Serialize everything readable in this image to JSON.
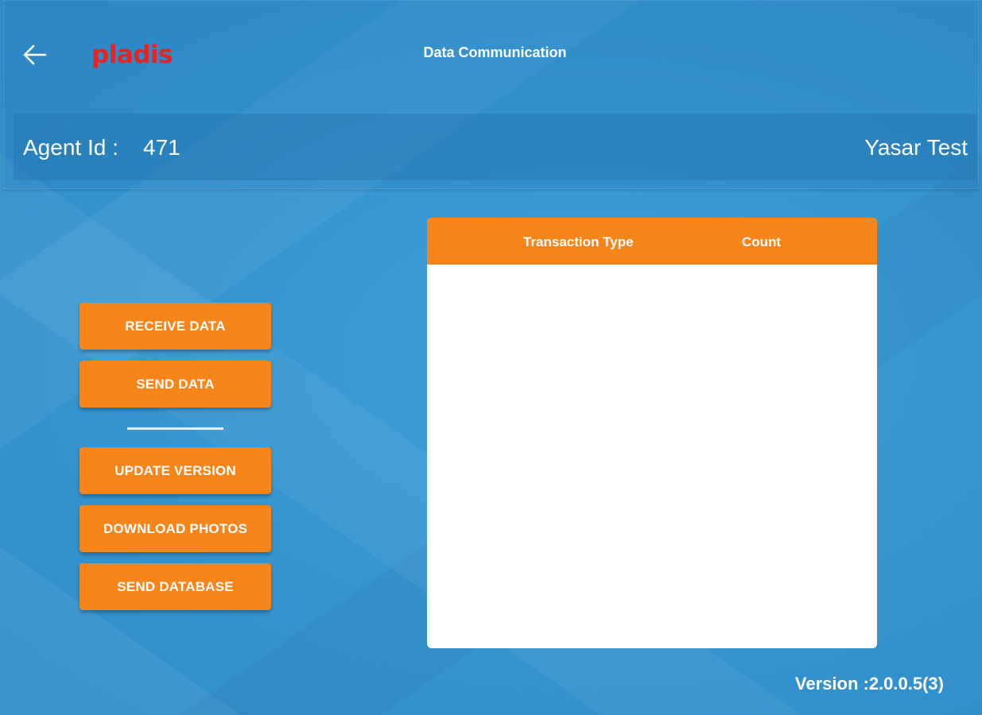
{
  "header": {
    "back_icon": "arrow-left-icon",
    "logo_text": "pladis",
    "title": "Data Communication"
  },
  "agent": {
    "label": "Agent Id :",
    "id": "471",
    "name": "Yasar Test"
  },
  "actions": {
    "receive_data": "RECEIVE DATA",
    "send_data": "SEND DATA",
    "update_version": "UPDATE VERSION",
    "download_photos": "DOWNLOAD PHOTOS",
    "send_database": "SEND DATABASE"
  },
  "table": {
    "columns": [
      "Transaction Type",
      "Count"
    ],
    "rows": []
  },
  "footer": {
    "version": "Version :2.0.0.5(3)"
  },
  "colors": {
    "accent": "#f7851a",
    "logo": "#e52323",
    "background": "#3696d1"
  }
}
